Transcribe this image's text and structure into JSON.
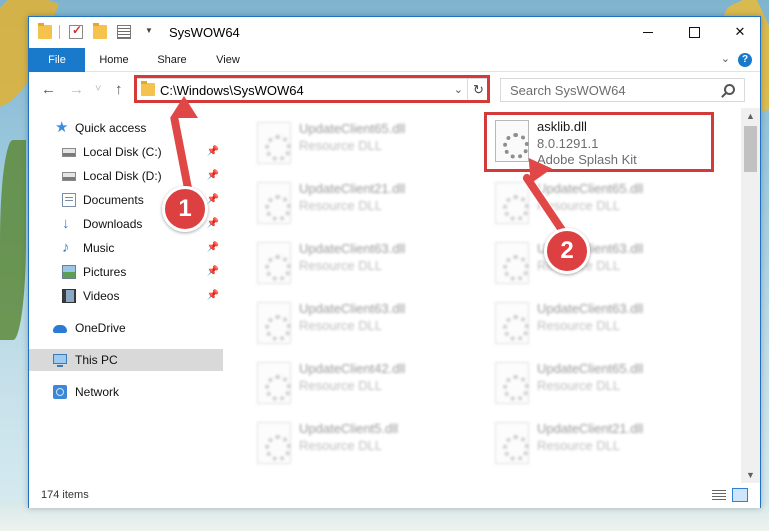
{
  "window": {
    "title": "SysWOW64",
    "controls": {
      "minimize": "",
      "maximize": "",
      "close": "✕"
    }
  },
  "ribbon": {
    "tabs": [
      "File",
      "Home",
      "Share",
      "View"
    ],
    "help": "?"
  },
  "navigation": {
    "back": "←",
    "forward": "→",
    "recent": "˅",
    "up": "↑",
    "address": "C:\\Windows\\SysWOW64",
    "refresh": "↻",
    "search_placeholder": "Search SysWOW64"
  },
  "sidebar": {
    "items": [
      {
        "label": "Quick access",
        "icon": "star-icon"
      },
      {
        "label": "Local Disk (C:)",
        "icon": "drive-icon",
        "pinned": true
      },
      {
        "label": "Local Disk (D:)",
        "icon": "drive-icon",
        "pinned": true
      },
      {
        "label": "Documents",
        "icon": "documents-icon",
        "pinned": true
      },
      {
        "label": "Downloads",
        "icon": "download-icon",
        "pinned": true
      },
      {
        "label": "Music",
        "icon": "music-icon",
        "pinned": true
      },
      {
        "label": "Pictures",
        "icon": "pictures-icon",
        "pinned": true
      },
      {
        "label": "Videos",
        "icon": "videos-icon",
        "pinned": true
      },
      {
        "label": "OneDrive",
        "icon": "cloud-icon"
      },
      {
        "label": "This PC",
        "icon": "pc-icon",
        "selected": true
      },
      {
        "label": "Network",
        "icon": "network-icon"
      }
    ]
  },
  "files": {
    "highlighted": {
      "name": "asklib.dll",
      "version": "8.0.1291.1",
      "description": "Adobe Splash Kit"
    },
    "column_left": [
      {
        "name": "UpdateClient65.dll",
        "description": "Resource DLL"
      },
      {
        "name": "UpdateClient21.dll",
        "description": "Resource DLL"
      },
      {
        "name": "UpdateClient63.dll",
        "description": "Resource DLL"
      },
      {
        "name": "UpdateClient63.dll",
        "description": "Resource DLL"
      },
      {
        "name": "UpdateClient42.dll",
        "description": "Resource DLL"
      },
      {
        "name": "UpdateClient5.dll",
        "description": "Resource DLL"
      }
    ],
    "column_right": [
      {
        "name": "UpdateClient65.dll",
        "description": "Resource DLL"
      },
      {
        "name": "UpdateClient63.dll",
        "description": "Resource DLL"
      },
      {
        "name": "UpdateClient63.dll",
        "description": "Resource DLL"
      },
      {
        "name": "UpdateClient65.dll",
        "description": "Resource DLL"
      },
      {
        "name": "UpdateClient21.dll",
        "description": "Resource DLL"
      }
    ]
  },
  "status": {
    "item_count": "174 items"
  },
  "callouts": [
    "1",
    "2"
  ],
  "colors": {
    "accent": "#1979ca",
    "highlight": "#d33a3a",
    "callout": "#dc4040"
  }
}
